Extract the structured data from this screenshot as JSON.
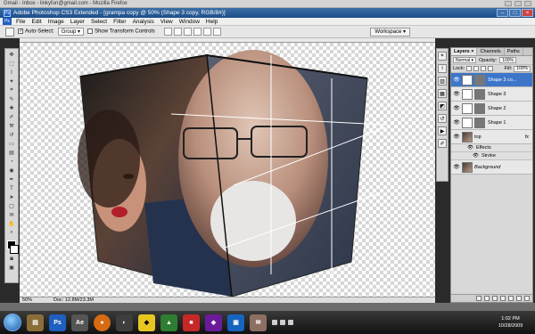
{
  "browser": {
    "title": "Gmail - Inbox - linkyfun@gmail.com - Mozilla Firefox"
  },
  "window": {
    "title": "Adobe Photoshop CS3 Extended - [grampa copy @ 50% (Shape 3 copy, RGB/8#)]"
  },
  "menu": [
    "File",
    "Edit",
    "Image",
    "Layer",
    "Select",
    "Filter",
    "Analysis",
    "View",
    "Window",
    "Help"
  ],
  "options": {
    "auto_select_label": "Auto-Select:",
    "auto_select_value": "Group",
    "show_transform_label": "Show Transform Controls",
    "workspace_label": "Workspace ▾"
  },
  "status": {
    "zoom": "50%",
    "doc": "Doc: 12.8M/23.3M"
  },
  "layers_panel": {
    "tabs": [
      "Layers ×",
      "Channels",
      "Paths"
    ],
    "blend_mode": "Normal",
    "opacity_label": "Opacity:",
    "opacity_value": "100%",
    "lock_label": "Lock:",
    "fill_label": "Fill:",
    "fill_value": "100%",
    "layers": [
      {
        "name": "Shape 3 co...",
        "selected": true
      },
      {
        "name": "Shape 3",
        "selected": false
      },
      {
        "name": "Shape 2",
        "selected": false
      },
      {
        "name": "Shape 1",
        "selected": false
      },
      {
        "name": "top",
        "selected": false
      },
      {
        "name": "Effects",
        "selected": false
      },
      {
        "name": "Stroke",
        "selected": false
      },
      {
        "name": "Background",
        "selected": false
      }
    ],
    "fx_label": "fx"
  },
  "taskbar": {
    "time": "1:02 PM",
    "date": "10/28/2009"
  },
  "colors": {
    "ps_blue": "#1f5fbf",
    "layer_selected": "#3d76c9",
    "taskbar_dark": "#111111"
  }
}
